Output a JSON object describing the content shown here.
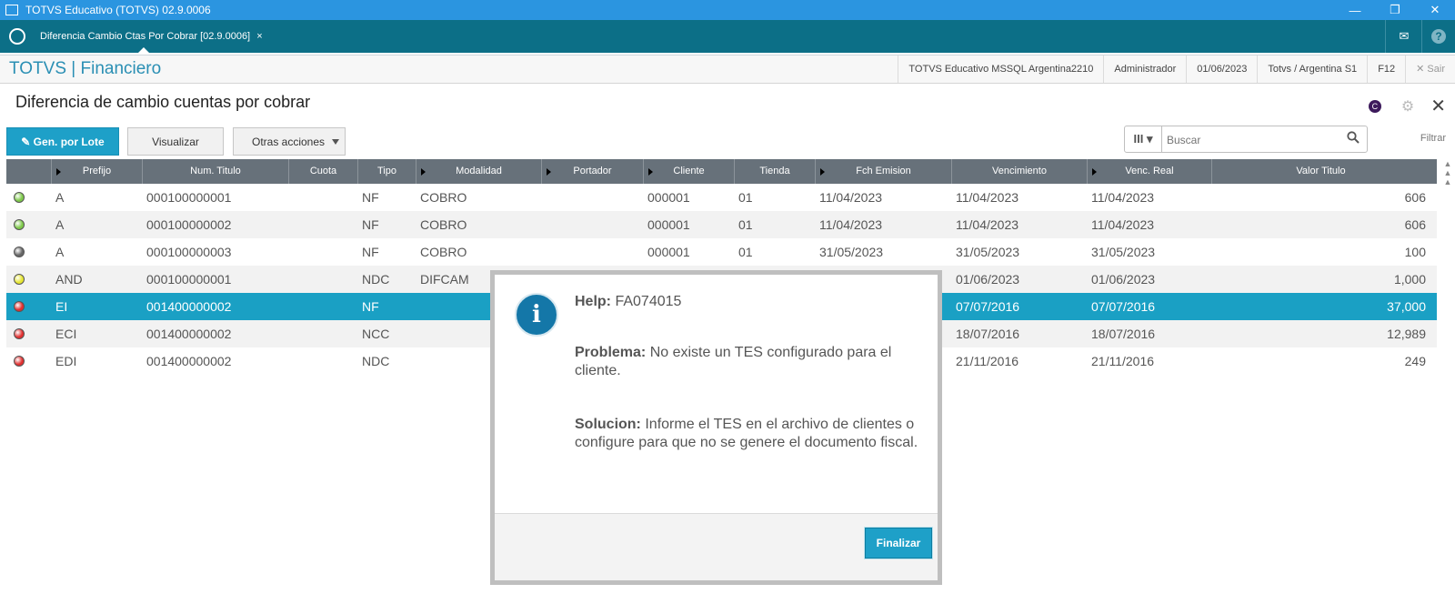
{
  "window": {
    "title": "TOTVS Educativo (TOTVS) 02.9.0006",
    "controls": [
      "—",
      "❐",
      "✕"
    ]
  },
  "tabbar": {
    "tab_label": "Diferencia Cambio Ctas Por Cobrar [02.9.0006]",
    "tab_close": "×",
    "mail_icon": "✉",
    "help_icon": "?"
  },
  "module": {
    "brand": "TOTVS | Financiero",
    "environment": "TOTVS Educativo MSSQL Argentina2210",
    "user": "Administrador",
    "date": "01/06/2023",
    "branch": "Totvs / Argentina S1",
    "shortcut": "F12",
    "exit_label": "✕  Sair"
  },
  "page": {
    "title": "Diferencia de cambio cuentas por cobrar",
    "header_badge": "C",
    "gear_icon": "⚙",
    "close_icon": "✕"
  },
  "toolbar": {
    "gen_lote": "✎ Gen. por Lote",
    "visualizar": "Visualizar",
    "otras_acciones": "Otras acciones",
    "search_placeholder": "Buscar",
    "columns_icon": "III ▾",
    "search_icon": "🔍",
    "filtrar": "Filtrar"
  },
  "grid": {
    "headers": [
      "",
      "Prefijo",
      "Num. Titulo",
      "Cuota",
      "Tipo",
      "Modalidad",
      "Portador",
      "Cliente",
      "Tienda",
      "Fch Emision",
      "Vencimiento",
      "Venc. Real",
      "Valor Titulo"
    ],
    "rows": [
      {
        "status_color": "#7ec94a",
        "prefijo": "A",
        "num": "000100000001",
        "cuota": "",
        "tipo": "NF",
        "modalidad": "COBRO",
        "portador": "",
        "cliente": "000001",
        "tienda": "01",
        "emision": "11/04/2023",
        "venc": "11/04/2023",
        "venc_real": "11/04/2023",
        "valor": "606"
      },
      {
        "status_color": "#7ec94a",
        "prefijo": "A",
        "num": "000100000002",
        "cuota": "",
        "tipo": "NF",
        "modalidad": "COBRO",
        "portador": "",
        "cliente": "000001",
        "tienda": "01",
        "emision": "11/04/2023",
        "venc": "11/04/2023",
        "venc_real": "11/04/2023",
        "valor": "606"
      },
      {
        "status_color": "#666666",
        "prefijo": "A",
        "num": "000100000003",
        "cuota": "",
        "tipo": "NF",
        "modalidad": "COBRO",
        "portador": "",
        "cliente": "000001",
        "tienda": "01",
        "emision": "31/05/2023",
        "venc": "31/05/2023",
        "venc_real": "31/05/2023",
        "valor": "100"
      },
      {
        "status_color": "#e6e632",
        "prefijo": "AND",
        "num": "000100000001",
        "cuota": "",
        "tipo": "NDC",
        "modalidad": "DIFCAM",
        "portador": "",
        "cliente": "",
        "tienda": "",
        "emision": "",
        "venc": "01/06/2023",
        "venc_real": "01/06/2023",
        "valor": "1,000"
      },
      {
        "status_color": "#e03030",
        "prefijo": "EI",
        "num": "001400000002",
        "cuota": "",
        "tipo": "NF",
        "modalidad": "",
        "portador": "",
        "cliente": "",
        "tienda": "",
        "emision": "",
        "venc": "07/07/2016",
        "venc_real": "07/07/2016",
        "valor": "37,000"
      },
      {
        "status_color": "#e03030",
        "prefijo": "ECI",
        "num": "001400000002",
        "cuota": "",
        "tipo": "NCC",
        "modalidad": "",
        "portador": "",
        "cliente": "",
        "tienda": "",
        "emision": "",
        "venc": "18/07/2016",
        "venc_real": "18/07/2016",
        "valor": "12,989"
      },
      {
        "status_color": "#e03030",
        "prefijo": "EDI",
        "num": "001400000002",
        "cuota": "",
        "tipo": "NDC",
        "modalidad": "",
        "portador": "",
        "cliente": "",
        "tienda": "",
        "emision": "",
        "venc": "21/11/2016",
        "venc_real": "21/11/2016",
        "valor": "249"
      }
    ],
    "selected_row": 4
  },
  "dialog": {
    "icon": "i",
    "help_label": "Help:",
    "help_code": "FA074015",
    "problem_label": "Problema:",
    "problem_text": "No existe un TES configurado para el cliente.",
    "solution_label": "Solucion:",
    "solution_text": "Informe el TES en el archivo de clientes o configure para que no se genere el documento fiscal.",
    "ok_button": "Finalizar"
  }
}
